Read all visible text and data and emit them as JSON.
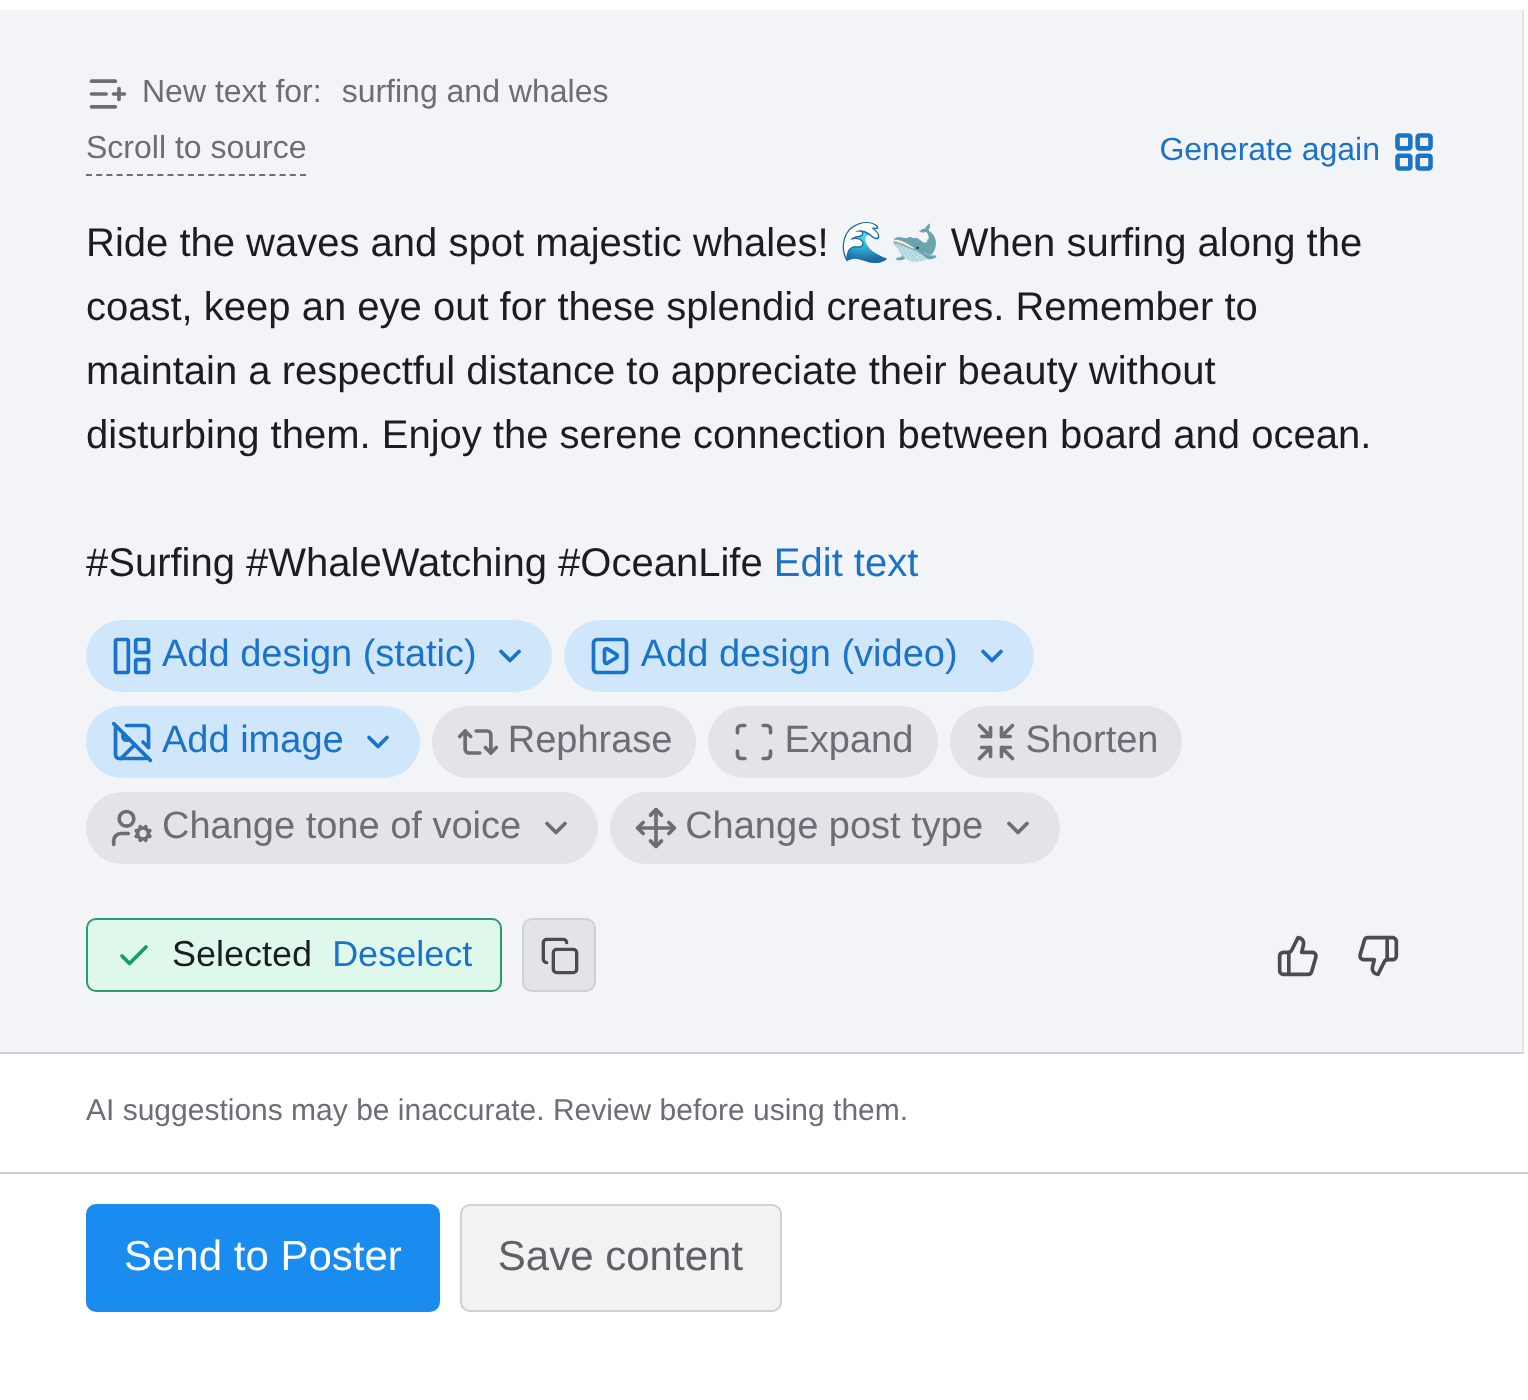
{
  "header": {
    "label": "New text for:",
    "topic": "surfing and whales",
    "scroll_link": "Scroll to source",
    "generate_link": "Generate again"
  },
  "body": "Ride the waves and spot majestic whales! 🌊🐋 When surfing along the coast, keep an eye out for these splendid creatures. Remember to maintain a respectful distance to appreciate their beauty without disturbing them. Enjoy the serene connection between board and ocean.",
  "hashtags": "#Surfing #WhaleWatching #OceanLife",
  "edit_link": "Edit text",
  "chips": [
    {
      "label": "Add design (static)",
      "kind": "accent",
      "dropdown": true
    },
    {
      "label": "Add design (video)",
      "kind": "accent",
      "dropdown": true
    },
    {
      "label": "Add image",
      "kind": "accent",
      "dropdown": true
    },
    {
      "label": "Rephrase",
      "kind": "neutral",
      "dropdown": false
    },
    {
      "label": "Expand",
      "kind": "neutral",
      "dropdown": false
    },
    {
      "label": "Shorten",
      "kind": "neutral",
      "dropdown": false
    },
    {
      "label": "Change tone of voice",
      "kind": "neutral",
      "dropdown": true
    },
    {
      "label": "Change post type",
      "kind": "neutral",
      "dropdown": true
    }
  ],
  "selection": {
    "selected": true,
    "label": "Selected",
    "action": "Deselect"
  },
  "disclaimer": "AI suggestions may be inaccurate. Review before using them.",
  "buttons": [
    {
      "label": "Send to Poster",
      "kind": "primary"
    },
    {
      "label": "Save content",
      "kind": "secondary"
    }
  ]
}
